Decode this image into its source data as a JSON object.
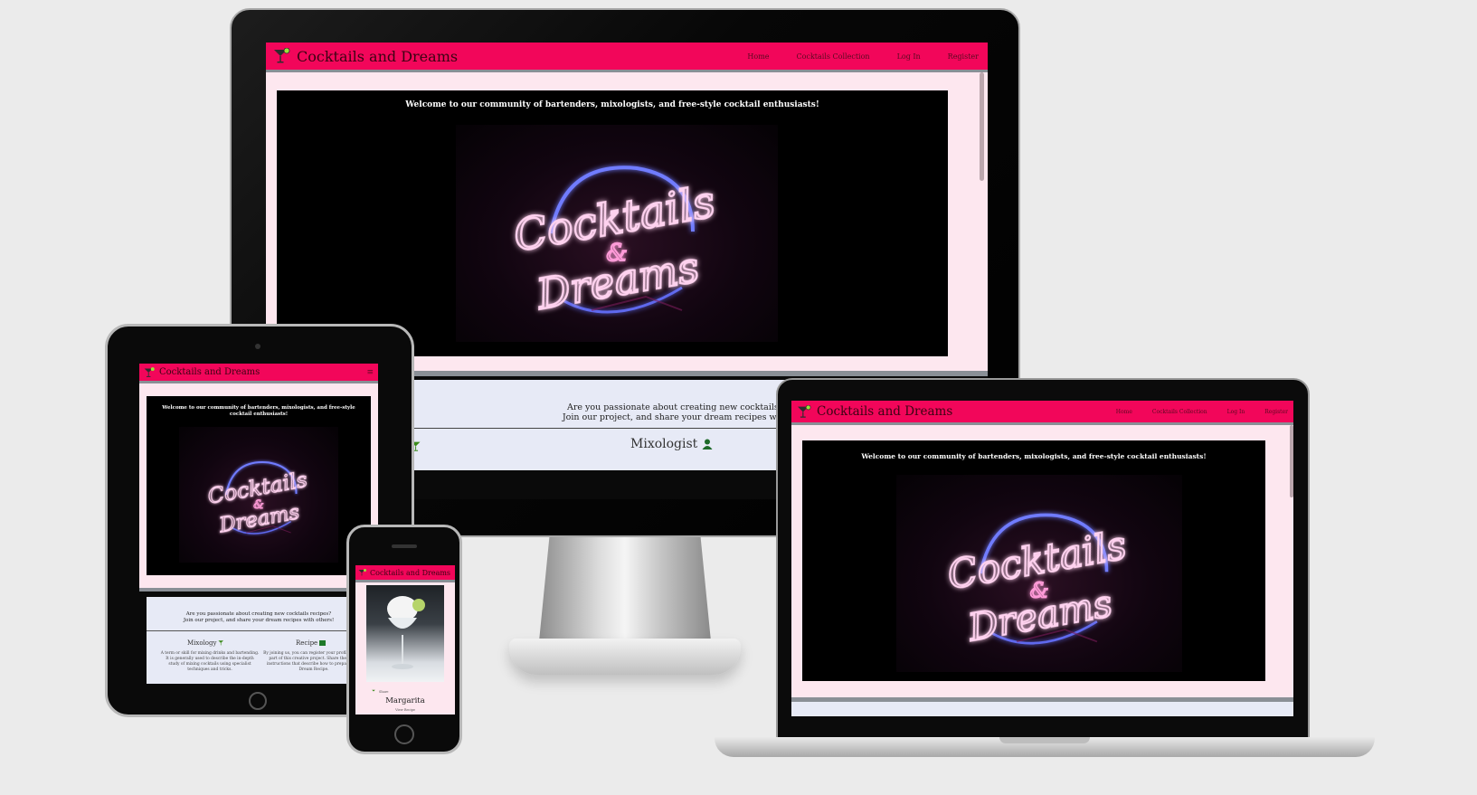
{
  "brand": {
    "name": "Cocktails and Dreams",
    "logo_icon": "cocktail-glass-icon"
  },
  "nav": {
    "links": [
      "Home",
      "Cocktails Collection",
      "Log In",
      "Register"
    ],
    "menu_icon": "hamburger-icon"
  },
  "hero": {
    "welcome": "Welcome to our community of bartenders, mixologists, and free-style cocktail enthusiasts!",
    "sign_line1": "Cocktails",
    "sign_amp": "&",
    "sign_line2": "Dreams"
  },
  "intro": {
    "line1": "Are you passionate about creating new cocktails recipes?",
    "line2": "Join our project, and share your dream recipes with others!"
  },
  "features": [
    {
      "title": "Mixology",
      "icon": "cocktail-glass-icon",
      "text": "A term or skill for mixing drinks and bartending. It is generally used to describe the in-depth study of mixing cocktails using specialist techniques and tricks."
    },
    {
      "title": "Recipe",
      "icon": "recipe-book-icon",
      "text": "By joining us, you can register your profile and be part of this creative project. Share the set of instructions that describe how to prepare Your Dream Recipe."
    },
    {
      "title": "Mixologist",
      "icon": "user-icon"
    }
  ],
  "monitor_feature_partial": "y",
  "phone_card": {
    "title": "Margarita",
    "tag": "Share",
    "author": "View Recipe"
  },
  "colors": {
    "accent": "#f2065a",
    "page_bg": "#fde7ef",
    "section_bg": "#e7eaf6",
    "frame_bg": "#ebebeb"
  }
}
